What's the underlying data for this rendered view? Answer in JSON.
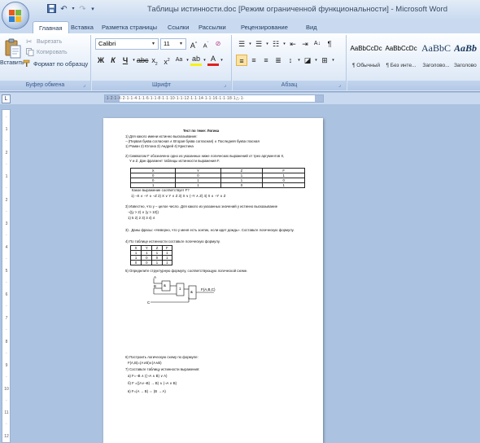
{
  "window": {
    "title": "Таблицы истинности.doc [Режим ограниченной функциональности] - Microsoft Word"
  },
  "tabs": [
    "Главная",
    "Вставка",
    "Разметка страницы",
    "Ссылки",
    "Рассылки",
    "Рецензирование",
    "Вид"
  ],
  "clipboard": {
    "paste": "Вставить",
    "cut": "Вырезать",
    "copy": "Копировать",
    "format_painter": "Формат по образцу",
    "label": "Буфер обмена"
  },
  "font": {
    "name": "Calibri",
    "size": "11",
    "label": "Шрифт"
  },
  "paragraph": {
    "label": "Абзац"
  },
  "styles": [
    {
      "sample": "AaBbCcDc",
      "name": "¶ Обычный"
    },
    {
      "sample": "AaBbCcDc",
      "name": "¶ Без инте..."
    },
    {
      "sample": "AaBbC",
      "name": "Заголово..."
    },
    {
      "sample": "AaBb",
      "name": "Заголово"
    }
  ],
  "ruler": {
    "corner": "L",
    "text": "·1·2·1·X·2·1·1·4·1·1·6·1·1·8·1·1·10·1·1·12·1·1·14·1·1·16·1·1·18·1△·1·"
  },
  "vruler_marks": [
    "·",
    "1",
    "·",
    "2",
    "·",
    "1",
    "·",
    "2",
    "·",
    "3",
    "·",
    "4",
    "·",
    "5",
    "·",
    "6",
    "·",
    "7",
    "·",
    "8",
    "·",
    "9",
    "·",
    "10",
    "·",
    "11",
    "·",
    "12"
  ],
  "document": {
    "heading": "Тест по теме: Логика",
    "q1": "1)  Для какого имени истинно высказывание:",
    "q1b": "¬ (Первая буква согласная ∧ Вторая буква согласная) ∧ Последняя буква гласная",
    "q1c": "1)  Роман 2) Юлона   3) Андрей  4) Кристина",
    "q2": "2)  Символом  F  обозначено одно из указанных ниже логических выражений от трех аргументов X,",
    "q2b": "Y и Z. Дан фрагмент таблицы истинности выражения F.",
    "table1_head": [
      "X",
      "Y",
      "Z",
      "F"
    ],
    "table1_rows": [
      [
        "0",
        "0",
        "1",
        "1"
      ],
      [
        "0",
        "1",
        "1",
        "0"
      ],
      [
        "1",
        "1",
        "0",
        "1"
      ]
    ],
    "q2c": "Какое выражение соответствует F?",
    "q2d": "1) ¬X ∧ ¬Y ∧ ¬Z      2) X ∨ Y ∨ Z      3) X ∨ (¬Y ∧ Z)      4) X ∧ ¬Y ∧ Z",
    "q3": "3) Известно, что у – целое число. Для какого из указанных значений у истинно высказывание",
    "q3b": "¬((y > 2) ∨ (y > 10))",
    "q3c": "1)      5       2) 2      3)  3       4) 4",
    "q4": "3)  . Даны фразы: «Неверно, что у меня есть зонтик, если идет дождь». Составьте логическую формулу.",
    "q5": "4)  По таблице истинности составьте логическую формулу.",
    "table2_head": [
      "X",
      "Y",
      "Z",
      "F"
    ],
    "table2_rows": [
      [
        "1",
        "1",
        "1",
        "1"
      ],
      [
        "1",
        "0",
        "0",
        "1"
      ],
      [
        "0",
        "0",
        "1",
        "1"
      ]
    ],
    "q6": "5)  Определите структурную формулу, соответствующую логической схеме.",
    "circuit_labels": {
      "a": "A",
      "b": "B",
      "c": "C",
      "out": "F(A,B,C)",
      "g1": "&",
      "g2": "1",
      "g3": "&"
    },
    "q7": "6)  Построить логическую схему по формуле:",
    "q7b": "F(A,B)=(A∨B)∧(A∧B)",
    "q8": "7)  Составьте  таблицу истинности выражения:",
    "q8a": "a) F=¬B ∧ ((¬A ∧ B) ∨ A)",
    "q8b": "б) F =((A∨¬B) → B) ∧ (¬A ∨ B)",
    "q8c": "в) F=(A → B) ⇔ (B → A)"
  }
}
